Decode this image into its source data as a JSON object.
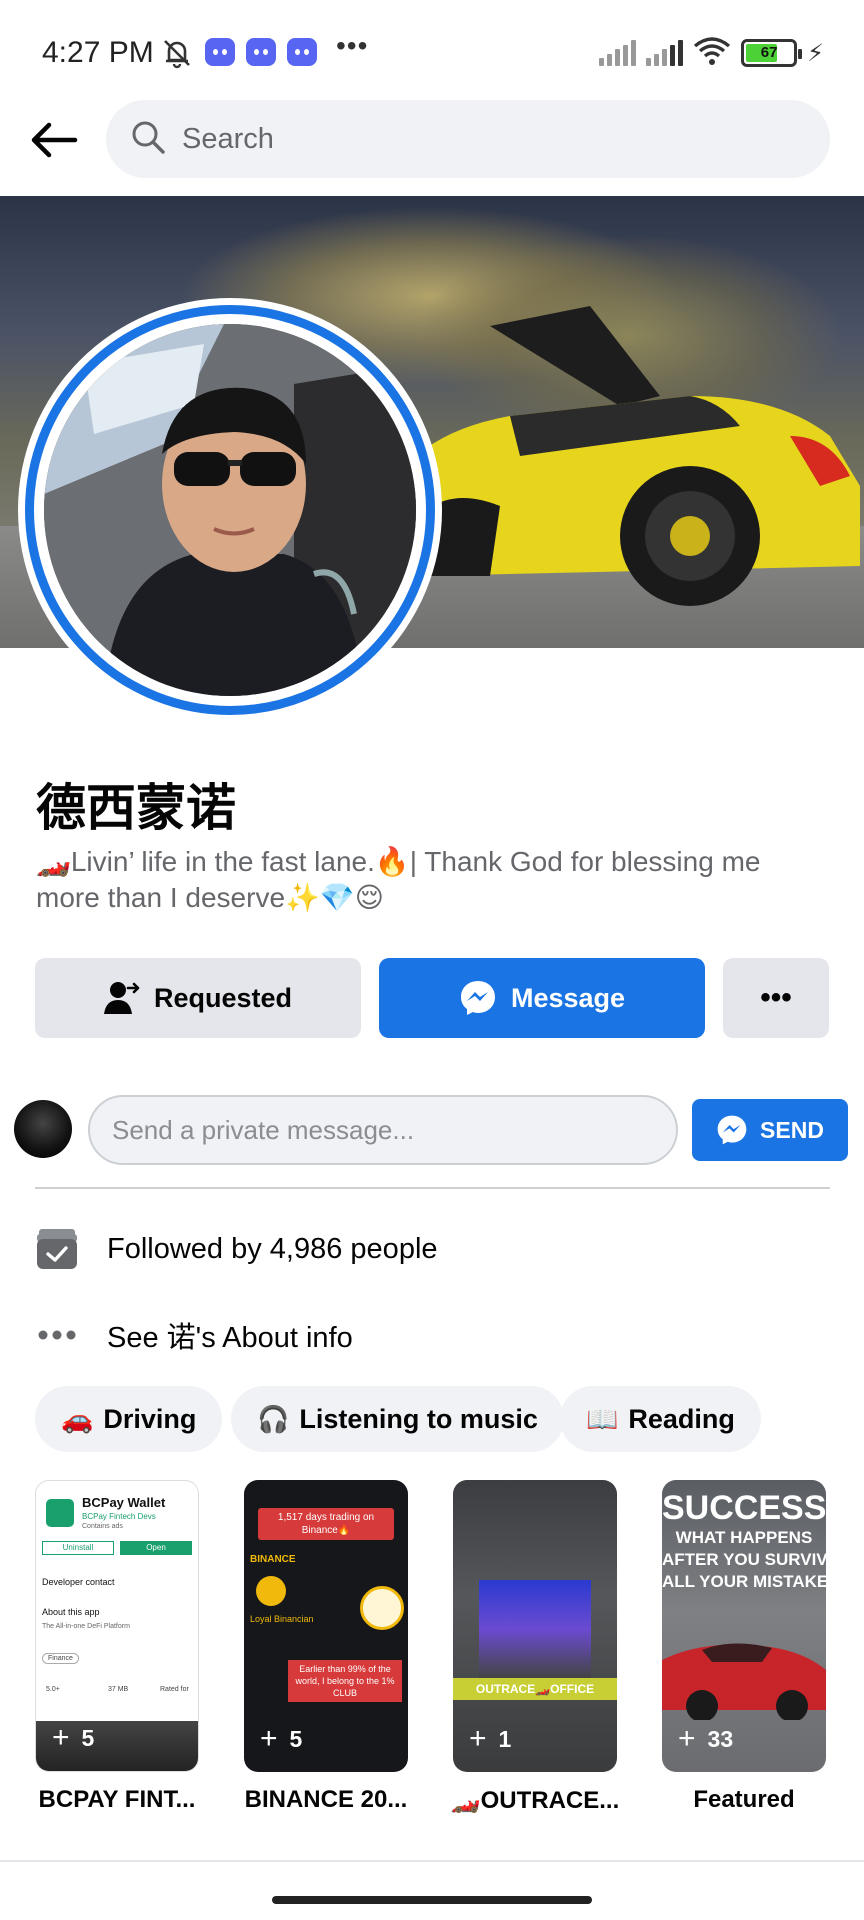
{
  "status_bar": {
    "time": "4:27 PM",
    "battery_level": "67",
    "icons": [
      "muted-bell-icon",
      "discord-icon",
      "discord-icon",
      "discord-icon",
      "more-dots-icon",
      "signal-icon",
      "signal-icon",
      "wifi-icon",
      "battery-icon",
      "charging-icon"
    ]
  },
  "nav": {
    "search_placeholder": "Search"
  },
  "profile": {
    "name": "德西蒙诺",
    "bio": "🏎️Livin’ life in the fast lane.🔥| Thank God for blessing me more than I deserve✨💎😌",
    "buttons": {
      "requested": "Requested",
      "message": "Message",
      "more": "•••"
    }
  },
  "private_message": {
    "placeholder": "Send a private message...",
    "send_label": "SEND"
  },
  "info": {
    "followed_by": "Followed by 4,986 people",
    "about": "See 诺's About info"
  },
  "hobbies": [
    {
      "emoji": "🚗",
      "label": "Driving"
    },
    {
      "emoji": "🎧",
      "label": "Listening to music"
    },
    {
      "emoji": "📖",
      "label": "Reading"
    }
  ],
  "featured": [
    {
      "count": "5",
      "label": "BCPAY FINT...",
      "title": "BCPay Wallet",
      "subtitle": "BCPay Fintech Devs",
      "extra1": "Contains ads",
      "btn1": "Uninstall",
      "btn2": "Open",
      "row1": "Developer contact",
      "row2": "About this app",
      "row3": "The All-in-one DeFi Platform",
      "tag": "Finance",
      "s1": "5.0+",
      "s2": "37 MB",
      "s3": "Rated for"
    },
    {
      "count": "5",
      "label": "BINANCE 20...",
      "banner": "1,517 days trading on Binance🔥",
      "brand": "BINANCE",
      "loyal": "Loyal Binancian",
      "badge": "Earlier than 99% of the world, I belong to the 1% CLUB"
    },
    {
      "count": "1",
      "label": "🏎️OUTRACE...",
      "sign": "OUTRACE🏎️OFFICE"
    },
    {
      "count": "33",
      "label": "Featured",
      "line1": "SUCCESS",
      "line2": "WHAT HAPPENS",
      "line3": "AFTER YOU SURVIVE",
      "line4": "ALL YOUR MISTAKES"
    }
  ],
  "colors": {
    "accent": "#1b74e4",
    "chip_bg": "#f0f2f5",
    "secondary_text": "#65676b"
  }
}
